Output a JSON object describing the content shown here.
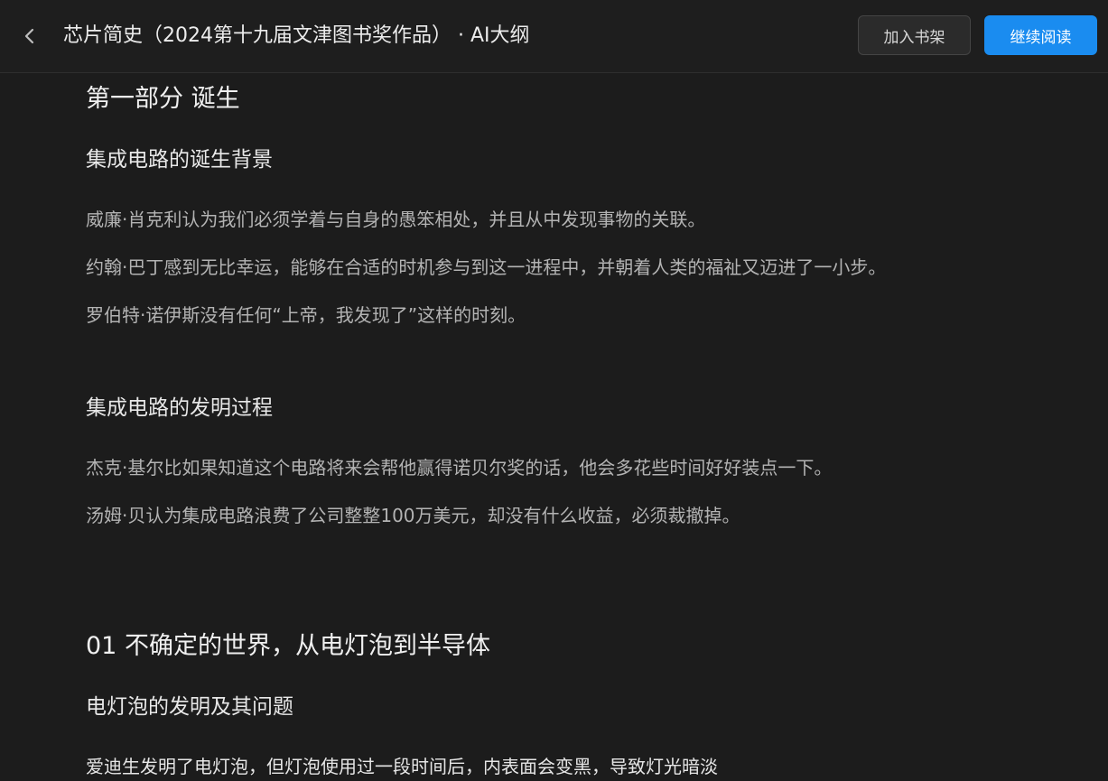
{
  "header": {
    "title": "芯片简史（2024第十九届文津图书奖作品） · AI大纲",
    "back_icon": "chevron-left-icon",
    "add_shelf_label": "加入书架",
    "continue_reading_label": "继续阅读",
    "accent_color": "#1a8cf0"
  },
  "outline": {
    "part1": {
      "title": "第一部分 诞生",
      "sections": [
        {
          "title": "集成电路的诞生背景",
          "points": [
            "威廉·肖克利认为我们必须学着与自身的愚笨相处，并且从中发现事物的关联。",
            "约翰·巴丁感到无比幸运，能够在合适的时机参与到这一进程中，并朝着人类的福祉又迈进了一小步。",
            "罗伯特·诺伊斯没有任何“上帝，我发现了”这样的时刻。"
          ]
        },
        {
          "title": "集成电路的发明过程",
          "points": [
            "杰克·基尔比如果知道这个电路将来会帮他赢得诺贝尔奖的话，他会多花些时间好好装点一下。",
            "汤姆·贝认为集成电路浪费了公司整整100万美元，却没有什么收益，必须裁撤掉。"
          ]
        }
      ]
    },
    "chapter1": {
      "title": "01 不确定的世界，从电灯泡到半导体",
      "sections": [
        {
          "title": "电灯泡的发明及其问题",
          "points": [
            "爱迪生发明了电灯泡，但灯泡使用过一段时间后，内表面会变黑，导致灯光暗淡"
          ]
        }
      ]
    }
  }
}
